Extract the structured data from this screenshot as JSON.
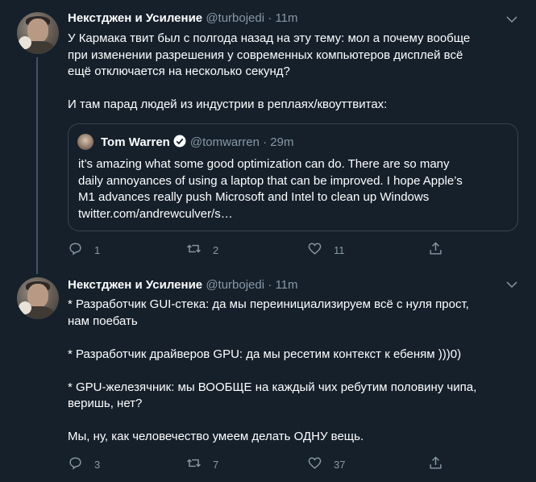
{
  "tweets": [
    {
      "author_name": "Некстджен и Усиление",
      "handle": "@turbojedi",
      "separator": "·",
      "time": "11m",
      "text": "У Кармака твит был с полгода назад на эту тему: мол а почему вообще\nпри изменении разрешения у современных компьютеров дисплей всё\nещё отключается на несколько секунд?\n\nИ там парад людей из индустрии в реплаях/квоуттвитах:",
      "quote": {
        "author_name": "Tom Warren",
        "handle": "@tomwarren",
        "separator": "·",
        "time": "29m",
        "text": "it’s amazing what some good optimization can do. There are so many\ndaily annoyances of using a laptop that can be improved. I hope Apple’s\nM1 advances really push Microsoft and Intel to clean up Windows\ntwitter.com/andrewculver/s…"
      },
      "replies": "1",
      "retweets": "2",
      "likes": "11"
    },
    {
      "author_name": "Некстджен и Усиление",
      "handle": "@turbojedi",
      "separator": "·",
      "time": "11m",
      "text": "* Разработчик GUI-стека: да мы переинициализируем всё с нуля прост,\nнам поебать\n\n* Разработчик драйверов GPU: да мы ресетим контекст к ебеням )))0)\n\n* GPU-железячник: мы ВООБЩЕ на каждый чих ребутим половину чипа,\nверишь, нет?\n\nМы, ну, как человечество умеем делать ОДНУ вещь.",
      "replies": "3",
      "retweets": "7",
      "likes": "37"
    }
  ],
  "icons": [
    "chevron-down-icon",
    "reply-icon",
    "retweet-icon",
    "like-icon",
    "share-icon",
    "verified-badge-icon"
  ],
  "colors": {
    "background": "#15202b",
    "muted": "#8899a6",
    "border": "#38444d",
    "text": "#ffffff"
  }
}
